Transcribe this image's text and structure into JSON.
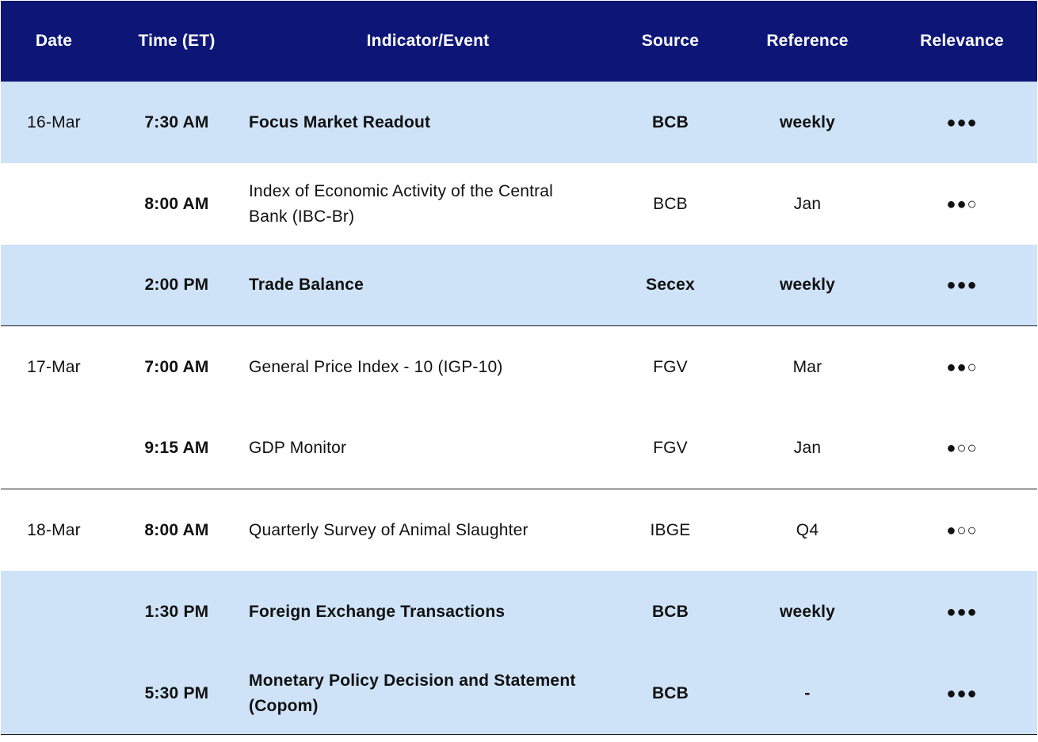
{
  "header": {
    "date": "Date",
    "time": "Time (ET)",
    "event": "Indicator/Event",
    "source": "Source",
    "reference": "Reference",
    "relevance": "Relevance"
  },
  "rows": [
    {
      "date": "16-Mar",
      "time": "7:30 AM",
      "event": "Focus Market Readout",
      "source": "BCB",
      "reference": "weekly",
      "relevance": "●●●"
    },
    {
      "date": "",
      "time": "8:00 AM",
      "event": "Index of Economic Activity of the Central Bank (IBC-Br)",
      "source": "BCB",
      "reference": "Jan",
      "relevance": "●●○"
    },
    {
      "date": "",
      "time": "2:00 PM",
      "event": "Trade Balance",
      "source": "Secex",
      "reference": "weekly",
      "relevance": "●●●"
    },
    {
      "date": "17-Mar",
      "time": "7:00 AM",
      "event": "General Price Index - 10 (IGP-10)",
      "source": "FGV",
      "reference": "Mar",
      "relevance": "●●○"
    },
    {
      "date": "",
      "time": "9:15 AM",
      "event": "GDP Monitor",
      "source": "FGV",
      "reference": "Jan",
      "relevance": "●○○"
    },
    {
      "date": "18-Mar",
      "time": "8:00 AM",
      "event": "Quarterly Survey of Animal Slaughter",
      "source": "IBGE",
      "reference": "Q4",
      "relevance": "●○○"
    },
    {
      "date": "",
      "time": "1:30 PM",
      "event": "Foreign Exchange Transactions",
      "source": "BCB",
      "reference": "weekly",
      "relevance": "●●●"
    },
    {
      "date": "",
      "time": "5:30 PM",
      "event": "Monetary Policy Decision and Statement (Copom)",
      "source": "BCB",
      "reference": "-",
      "relevance": "●●●"
    }
  ],
  "colors": {
    "header_bg": "#0d1677",
    "highlight_bg": "#cfe3f8"
  }
}
